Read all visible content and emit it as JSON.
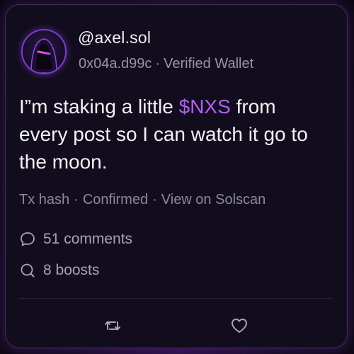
{
  "post": {
    "handle": "@axel.sol",
    "wallet": "0x04a.d99c",
    "separator": "·",
    "verified_label": "Verified Wallet",
    "text_before": "I”m staking a little ",
    "ticker": "$NXS",
    "text_after": " from every post so I can watch it go to the moon.",
    "meta": {
      "tx_hash": "Tx hash",
      "status": "Confirmed",
      "link": "View on Solscan"
    },
    "stats": {
      "comments": "51 comments",
      "boosts": "8 boosts"
    }
  },
  "icons": {
    "comment": "comment-bubble-icon",
    "boost": "search-loop-icon",
    "retweet": "retweet-icon",
    "like": "heart-icon"
  },
  "colors": {
    "accent": "#b45cff",
    "card_border": "#3a2a55",
    "text_primary": "#f3f0f7",
    "text_secondary": "#9a93a8"
  }
}
